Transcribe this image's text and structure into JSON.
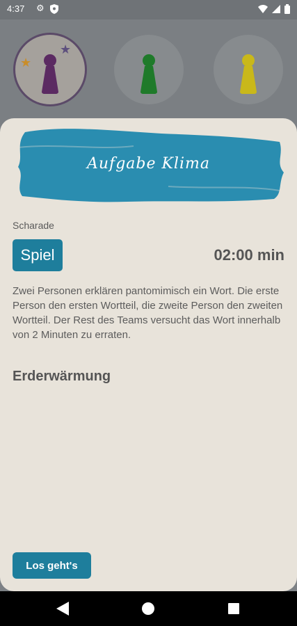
{
  "status_bar": {
    "time": "4:37",
    "icons": [
      "gear-icon",
      "shield-icon",
      "wifi-icon",
      "signal-icon",
      "battery-icon"
    ]
  },
  "players": [
    {
      "color": "#5b2a62",
      "active": true,
      "stars": [
        "#c98d2a",
        "#5d4f7d"
      ]
    },
    {
      "color": "#1f7a2a",
      "active": false
    },
    {
      "color": "#c9b81a",
      "active": false
    }
  ],
  "task": {
    "title": "Aufgabe Klima",
    "category": "Scharade",
    "type_label": "Spiel",
    "timer": "02:00 min",
    "description": "Zwei Personen erklären pantomimisch ein Wort. Die erste Person den ersten Wortteil, die zweite Person den zweiten Wortteil. Der Rest des Teams versucht das Wort innerhalb von 2 Minuten zu erraten.",
    "word": "Erderwärmung",
    "start_button": "Los geht's"
  },
  "colors": {
    "accent": "#1e7e9c",
    "banner": "#2a8db0",
    "sheet": "#e8e3da"
  },
  "nav": [
    "back-icon",
    "home-icon",
    "recents-icon"
  ]
}
